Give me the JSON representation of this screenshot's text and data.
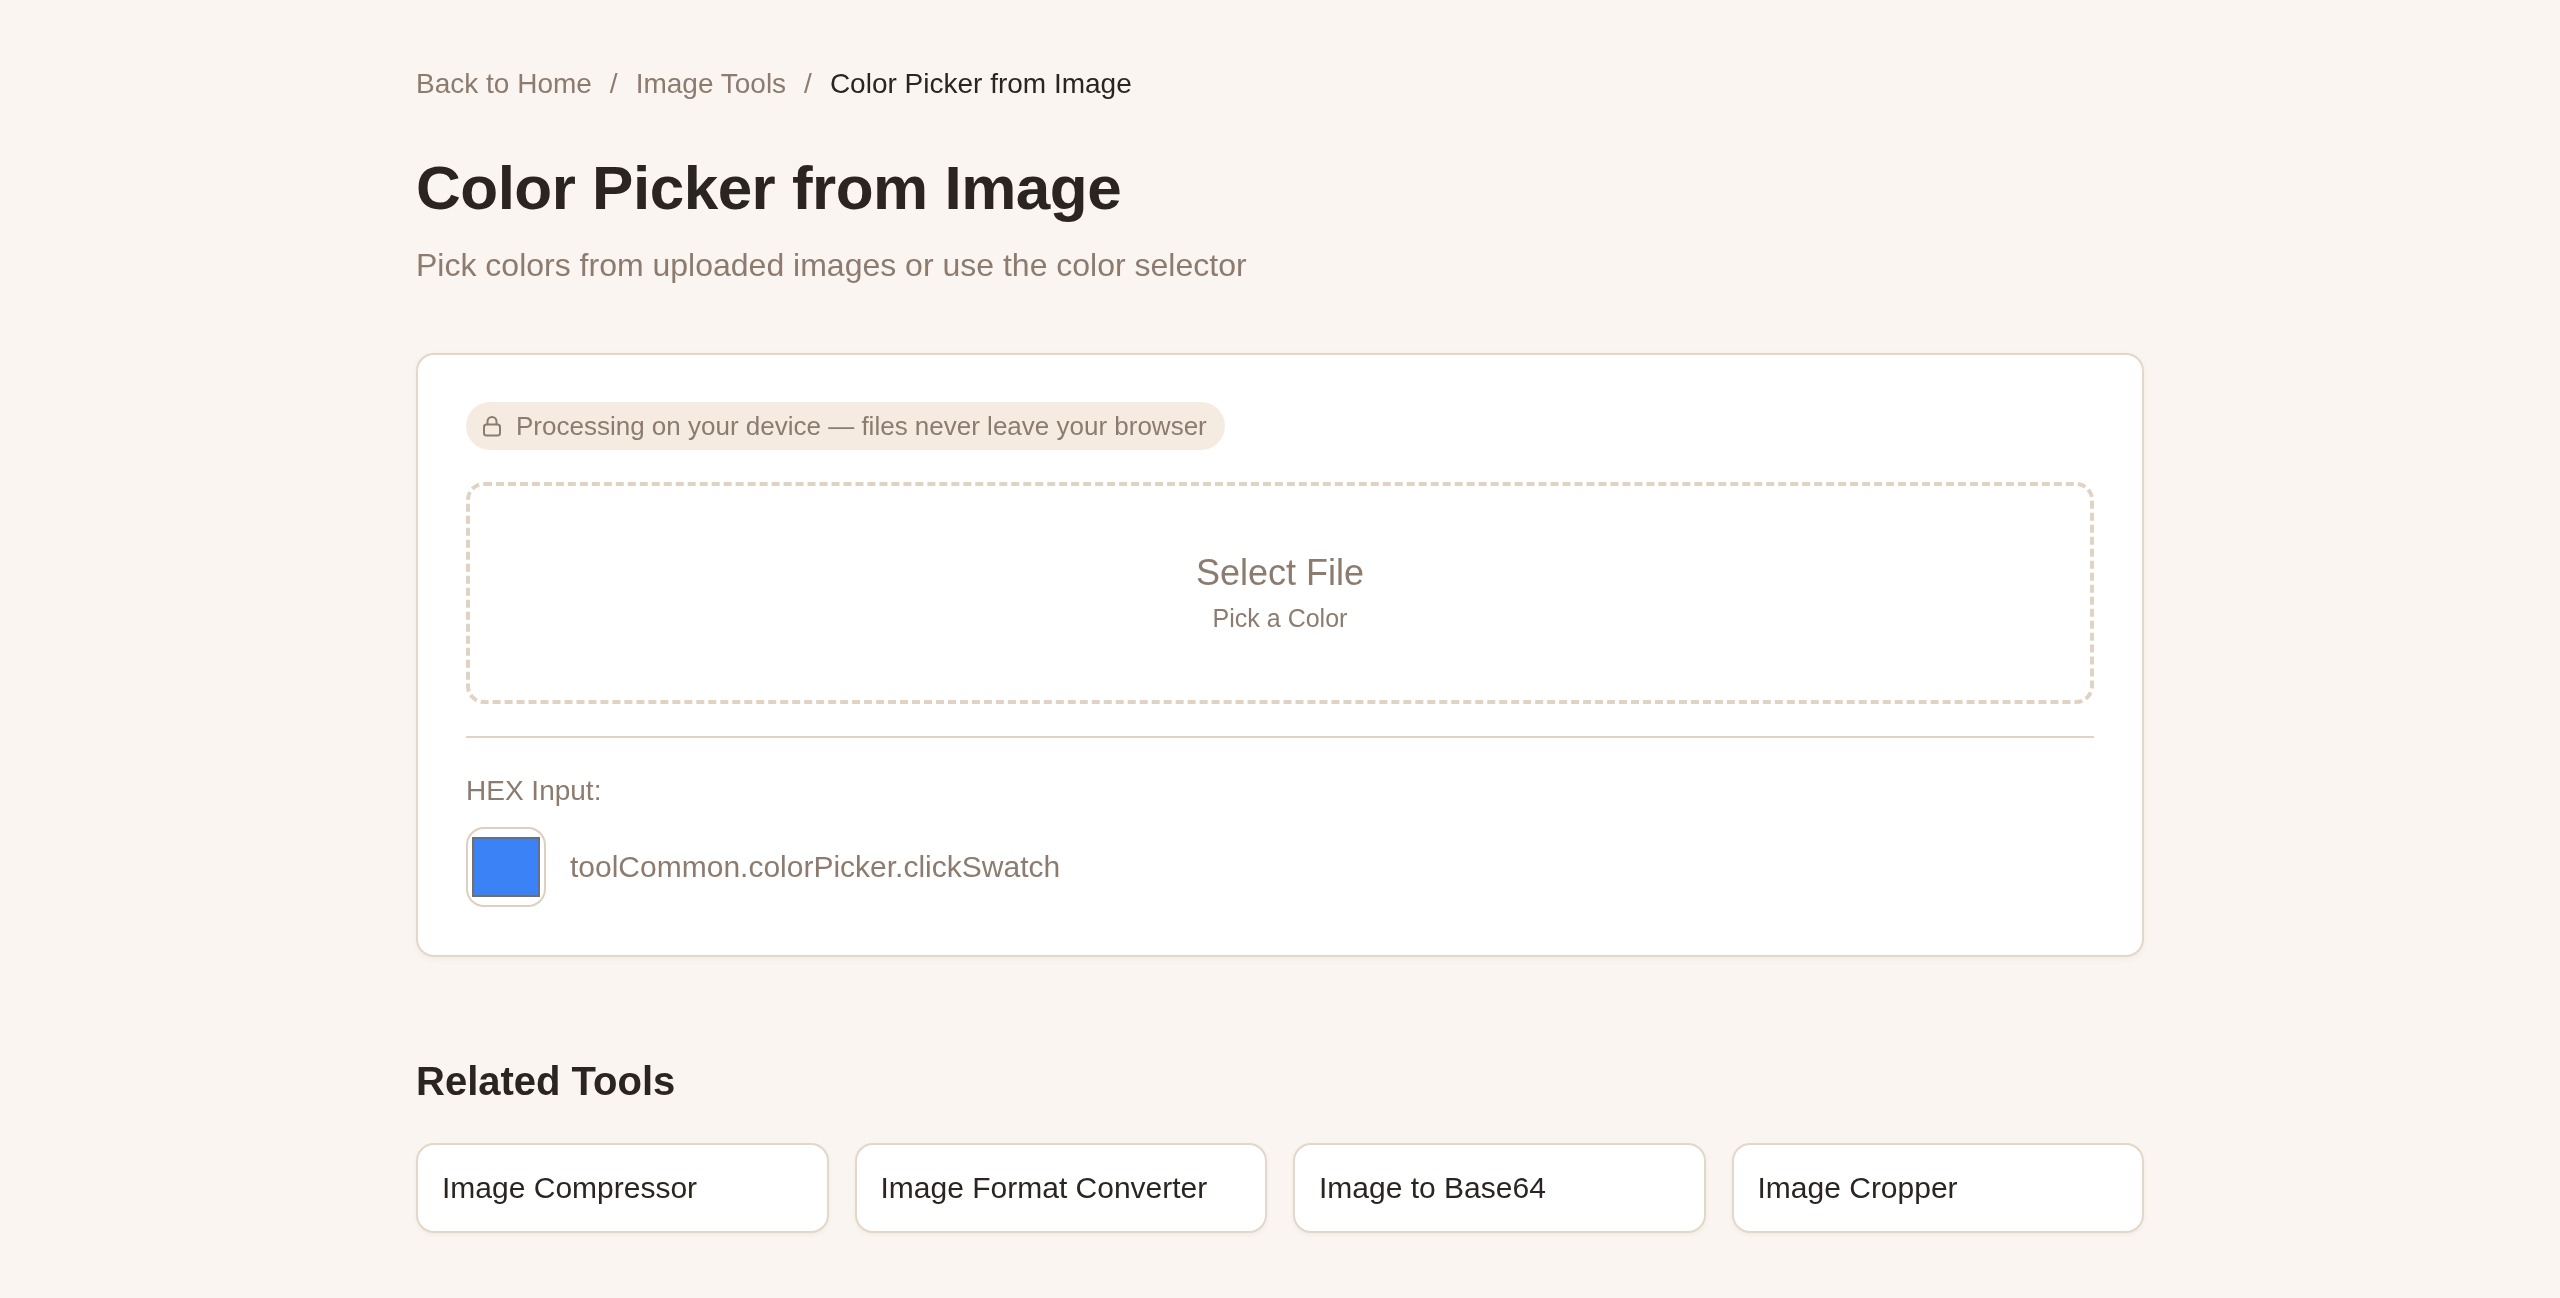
{
  "breadcrumb": [
    {
      "kind": "link",
      "text": "Back to Home"
    },
    {
      "kind": "separator",
      "text": "/"
    },
    {
      "kind": "link",
      "text": "Image Tools"
    },
    {
      "kind": "separator",
      "text": "/"
    },
    {
      "kind": "current",
      "text": "Color Picker from Image"
    }
  ],
  "page": {
    "title": "Color Picker from Image",
    "subtitle": "Pick colors from uploaded images or use the color selector"
  },
  "tool_card": {
    "privacy_badge": "Processing on your device — files never leave your browser",
    "drop_zone": {
      "title": "Select File",
      "hint": "Pick a Color"
    },
    "hex_input": {
      "label": "HEX Input:",
      "color": "#3b82f6",
      "instruction": "toolCommon.colorPicker.clickSwatch"
    }
  },
  "related_tools": {
    "title": "Related Tools",
    "items": [
      "Image Compressor",
      "Image Format Converter",
      "Image to Base64",
      "Image Cropper"
    ]
  }
}
